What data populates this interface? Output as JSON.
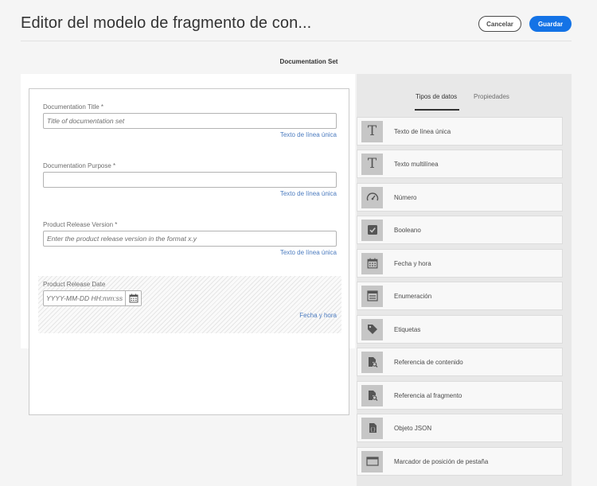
{
  "header": {
    "title": "Editor del modelo de fragmento de con...",
    "cancel_label": "Cancelar",
    "save_label": "Guardar"
  },
  "model_name": "Documentation Set",
  "form": {
    "fields": [
      {
        "label": "Documentation Title *",
        "placeholder": "Title of documentation set",
        "type": "Texto de línea única"
      },
      {
        "label": "Documentation Purpose *",
        "placeholder": "",
        "type": "Texto de línea única"
      },
      {
        "label": "Product Release Version *",
        "placeholder": "Enter the product release version in the format x.y",
        "type": "Texto de línea única"
      }
    ],
    "date_field": {
      "label": "Product Release Date",
      "placeholder": "YYYY-MM-DD HH:mm:ss",
      "type": "Fecha y hora",
      "icon": "calendar-icon"
    }
  },
  "side_panel": {
    "tabs": [
      {
        "label": "Tipos de datos",
        "active": true
      },
      {
        "label": "Propiedades",
        "active": false
      }
    ],
    "data_types": [
      {
        "label": "Texto de línea única",
        "icon": "text-t-icon"
      },
      {
        "label": "Texto multilínea",
        "icon": "text-t-icon"
      },
      {
        "label": "Número",
        "icon": "gauge-icon"
      },
      {
        "label": "Booleano",
        "icon": "checkbox-icon"
      },
      {
        "label": "Fecha y hora",
        "icon": "calendar-icon"
      },
      {
        "label": "Enumeración",
        "icon": "list-icon"
      },
      {
        "label": "Etiquetas",
        "icon": "tag-icon"
      },
      {
        "label": "Referencia de contenido",
        "icon": "file-search-icon"
      },
      {
        "label": "Referencia al fragmento",
        "icon": "file-search-icon"
      },
      {
        "label": "Objeto JSON",
        "icon": "json-file-icon"
      },
      {
        "label": "Marcador de posición de pestaña",
        "icon": "tab-placeholder-icon"
      }
    ]
  },
  "colors": {
    "accent": "#1473e6",
    "field_type_link": "#4b7bbf",
    "panel_bg": "#e8e8e8"
  }
}
